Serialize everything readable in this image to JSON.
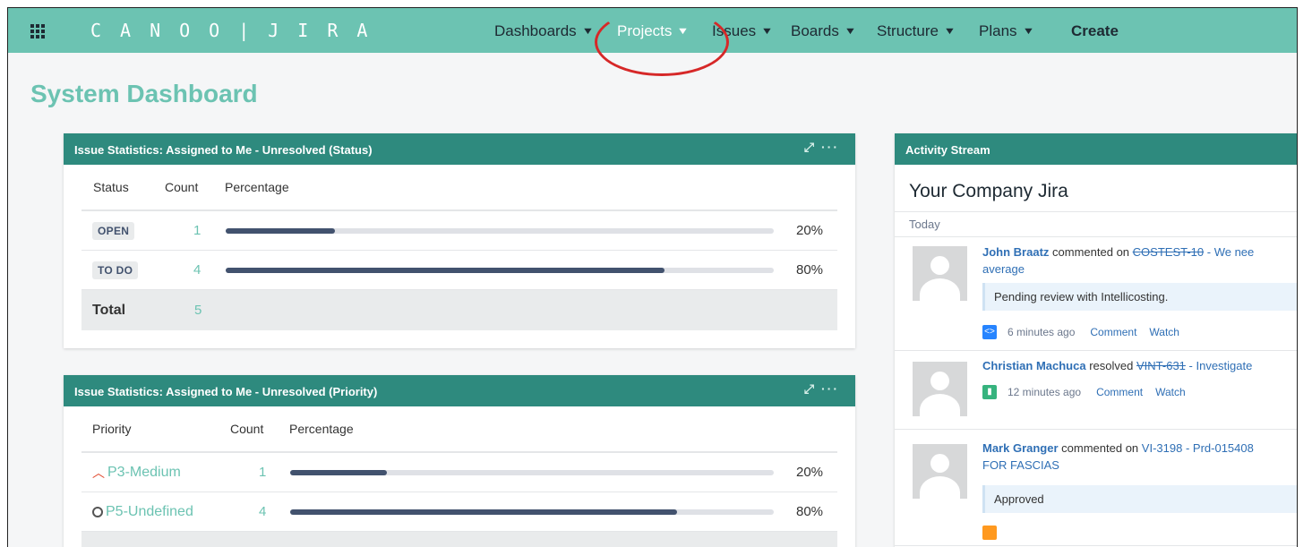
{
  "nav": {
    "logo": "CANOO",
    "logo_sep": "|",
    "logo_product": "JIRA",
    "items": [
      {
        "label": "Dashboards",
        "chevron": "▼"
      },
      {
        "label": "Projects",
        "chevron": "▼"
      },
      {
        "label": "ssues",
        "chevron": "▼"
      },
      {
        "label": "Boards",
        "chevron": "▼"
      },
      {
        "label": "Structure",
        "chevron": "▼"
      },
      {
        "label": "Plans",
        "chevron": "▼"
      }
    ],
    "create_label": "Create",
    "active_item": "Projects",
    "issues_first_letter": "I",
    "icons": {
      "apps": "app-switcher-grid-icon",
      "chevron": "chevron-down-icon"
    }
  },
  "page": {
    "title": "System Dashboard"
  },
  "gadget_status": {
    "title": "Issue Statistics: Assigned to Me - Unresolved (Status)",
    "tools": "⤢ ···",
    "headers": {
      "col1": "Status",
      "col2": "Count",
      "col3": "Percentage"
    },
    "rows": [
      {
        "label": "OPEN",
        "count": "1",
        "percent_text": "20%",
        "percent": 0.2
      },
      {
        "label": "TO DO",
        "count": "4",
        "percent_text": "80%",
        "percent": 0.8
      }
    ],
    "total_label": "Total",
    "total_count": "5"
  },
  "gadget_priority": {
    "title": "Issue Statistics: Assigned to Me - Unresolved (Priority)",
    "tools": "⤢ ···",
    "headers": {
      "col1": "Priority",
      "col2": "Count",
      "col3": "Percentage"
    },
    "rows": [
      {
        "label": "P3-Medium",
        "icon": "priority-medium-icon",
        "count": "1",
        "percent_text": "20%",
        "percent": 0.2
      },
      {
        "label": "P5-Undefined",
        "icon": "priority-undefined-icon",
        "count": "4",
        "percent_text": "80%",
        "percent": 0.8
      }
    ]
  },
  "activity": {
    "header": "Activity Stream",
    "title": "Your Company Jira",
    "date_label": "Today",
    "entries": [
      {
        "user": "John Braatz",
        "action": "commented on",
        "issue": "COSTEST-10",
        "issue_summary": "- We nee",
        "issue_summary_line2": "average",
        "comment": "Pending review with Intellicosting.",
        "time": "6 minutes ago",
        "comment_link": "Comment",
        "watch_link": "Watch",
        "type_icon": "<>",
        "type_color": "#2684ff"
      },
      {
        "user": "Christian Machuca",
        "action": "resolved",
        "issue": "VINT-631",
        "issue_summary": "- Investigate",
        "time": "12 minutes ago",
        "comment_link": "Comment",
        "watch_link": "Watch",
        "type_icon": "▮",
        "type_color": "#36b37e"
      },
      {
        "user": "Mark Granger",
        "action": "commented on",
        "issue": "VI-3198",
        "issue_summary": "- Prd-015408",
        "issue_summary_line2": "FOR FASCIAS",
        "comment": "Approved",
        "type_color": "#ff991f"
      }
    ]
  },
  "colors": {
    "nav_bg": "#6cc3b2",
    "gadget_header": "#2e8a7e",
    "bar_fill": "#42526e",
    "highlight_circle": "#d62828"
  }
}
